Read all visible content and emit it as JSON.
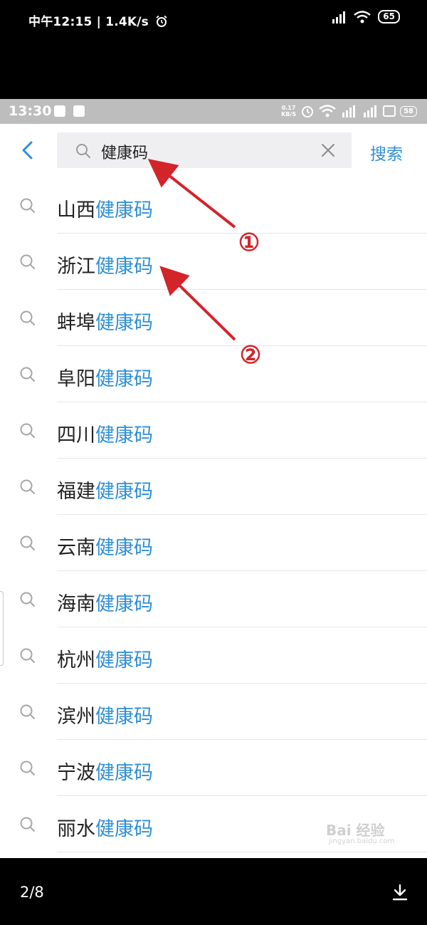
{
  "outer_status": {
    "time": "中午12:15",
    "speed": "1.4K/s",
    "battery": "65"
  },
  "inner_status": {
    "time": "13:30",
    "speed_value": "0.17",
    "speed_unit": "KB/S",
    "battery": "58"
  },
  "search": {
    "query": "健康码",
    "submit_label": "搜索"
  },
  "results": [
    {
      "prefix": "山西",
      "keyword": "健康码"
    },
    {
      "prefix": "浙江",
      "keyword": "健康码"
    },
    {
      "prefix": "蚌埠",
      "keyword": "健康码"
    },
    {
      "prefix": "阜阳",
      "keyword": "健康码"
    },
    {
      "prefix": "四川",
      "keyword": "健康码"
    },
    {
      "prefix": "福建",
      "keyword": "健康码"
    },
    {
      "prefix": "云南",
      "keyword": "健康码"
    },
    {
      "prefix": "海南",
      "keyword": "健康码"
    },
    {
      "prefix": "杭州",
      "keyword": "健康码"
    },
    {
      "prefix": "滨州",
      "keyword": "健康码"
    },
    {
      "prefix": "宁波",
      "keyword": "健康码"
    },
    {
      "prefix": "丽水",
      "keyword": "健康码"
    }
  ],
  "annotations": {
    "marker_1": "①",
    "marker_2": "②",
    "color": "#d3242a"
  },
  "watermark": {
    "brand": "Bai 经验",
    "url": "jingyan.baidu.com"
  },
  "viewer": {
    "page_indicator": "2/8"
  },
  "colors": {
    "accent": "#2f8fd6",
    "annotation": "#d3242a"
  }
}
